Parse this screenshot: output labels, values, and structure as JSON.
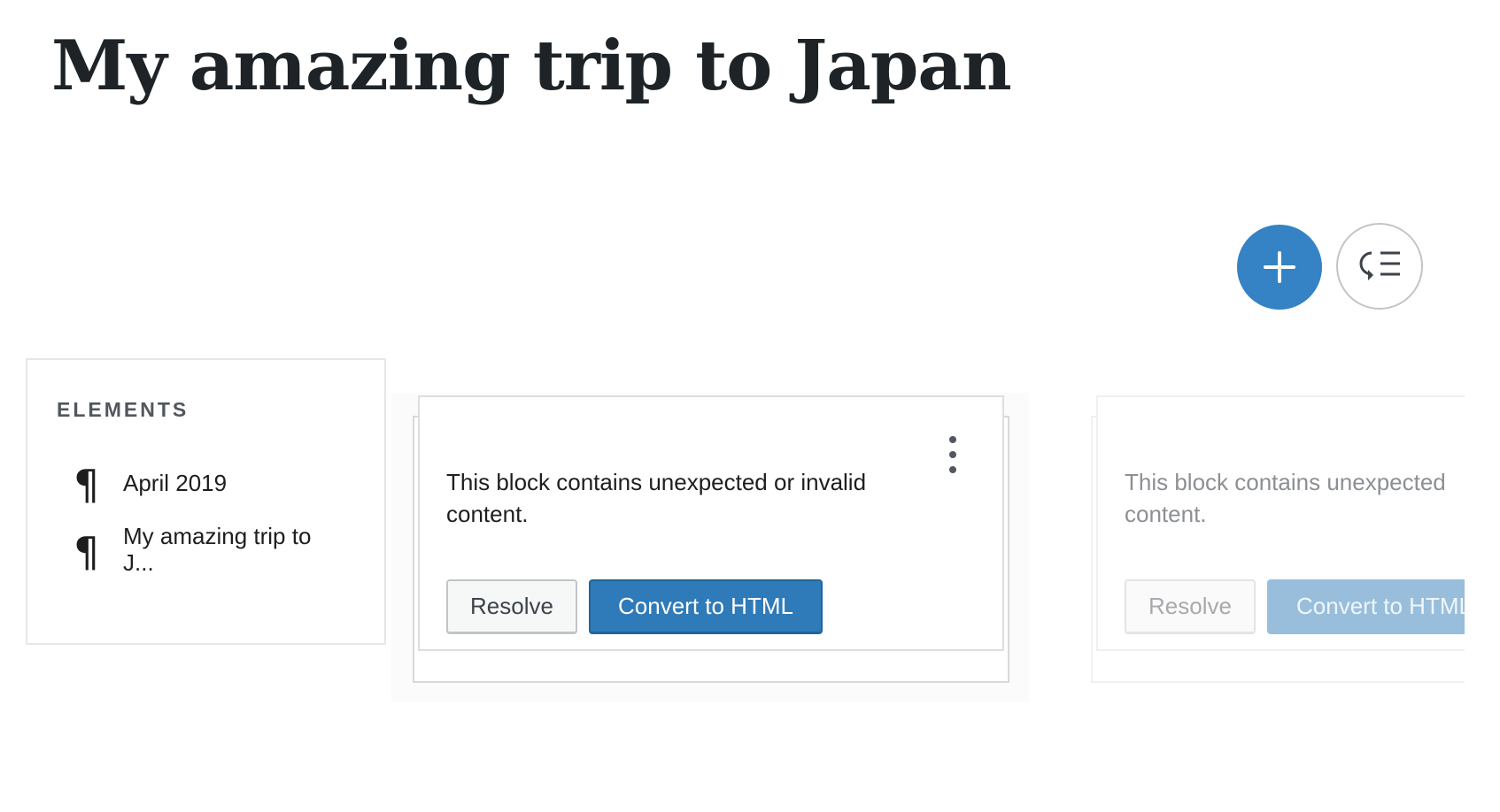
{
  "post": {
    "title": "My amazing trip to Japan"
  },
  "toolbar": {
    "add_icon": "plus-icon",
    "outline_icon": "block-navigation-icon",
    "accent_color": "#3582c4"
  },
  "elements_panel": {
    "heading": "ELEMENTS",
    "items": [
      {
        "icon": "paragraph-icon",
        "label": "April 2019"
      },
      {
        "icon": "paragraph-icon",
        "label": "My amazing trip to J..."
      }
    ]
  },
  "block_warning": {
    "message": "This block contains unexpected or invalid content.",
    "menu_icon": "more-vertical-icon",
    "resolve_label": "Resolve",
    "convert_label": "Convert to HTML"
  },
  "faded_block_warning": {
    "message_line1": "This block contains unexpected",
    "message_line2": "content.",
    "resolve_label": "Resolve",
    "convert_label": "Convert to HTML"
  }
}
